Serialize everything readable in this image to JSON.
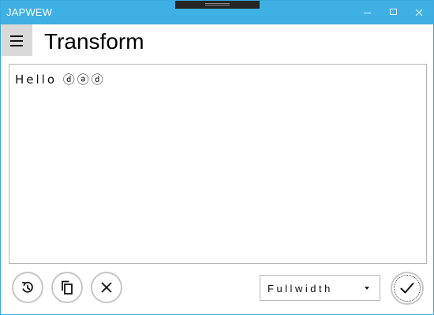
{
  "app": {
    "title": "JAPWEW"
  },
  "header": {
    "title": "Transform"
  },
  "editor": {
    "text": "Hello ⓓⓐⓓ"
  },
  "toolbar": {
    "mode_selected": "Fullwidth"
  },
  "icons": {
    "menu": "hamburger-menu-icon",
    "reset": "history-icon",
    "copy": "copy-icon",
    "clear": "close-icon",
    "dropdown": "caret-down-icon",
    "apply": "checkmark-icon"
  },
  "colors": {
    "titlebar": "#3eb0e3",
    "menu_background": "#d9d9d9",
    "border": "#b3b3b3"
  }
}
